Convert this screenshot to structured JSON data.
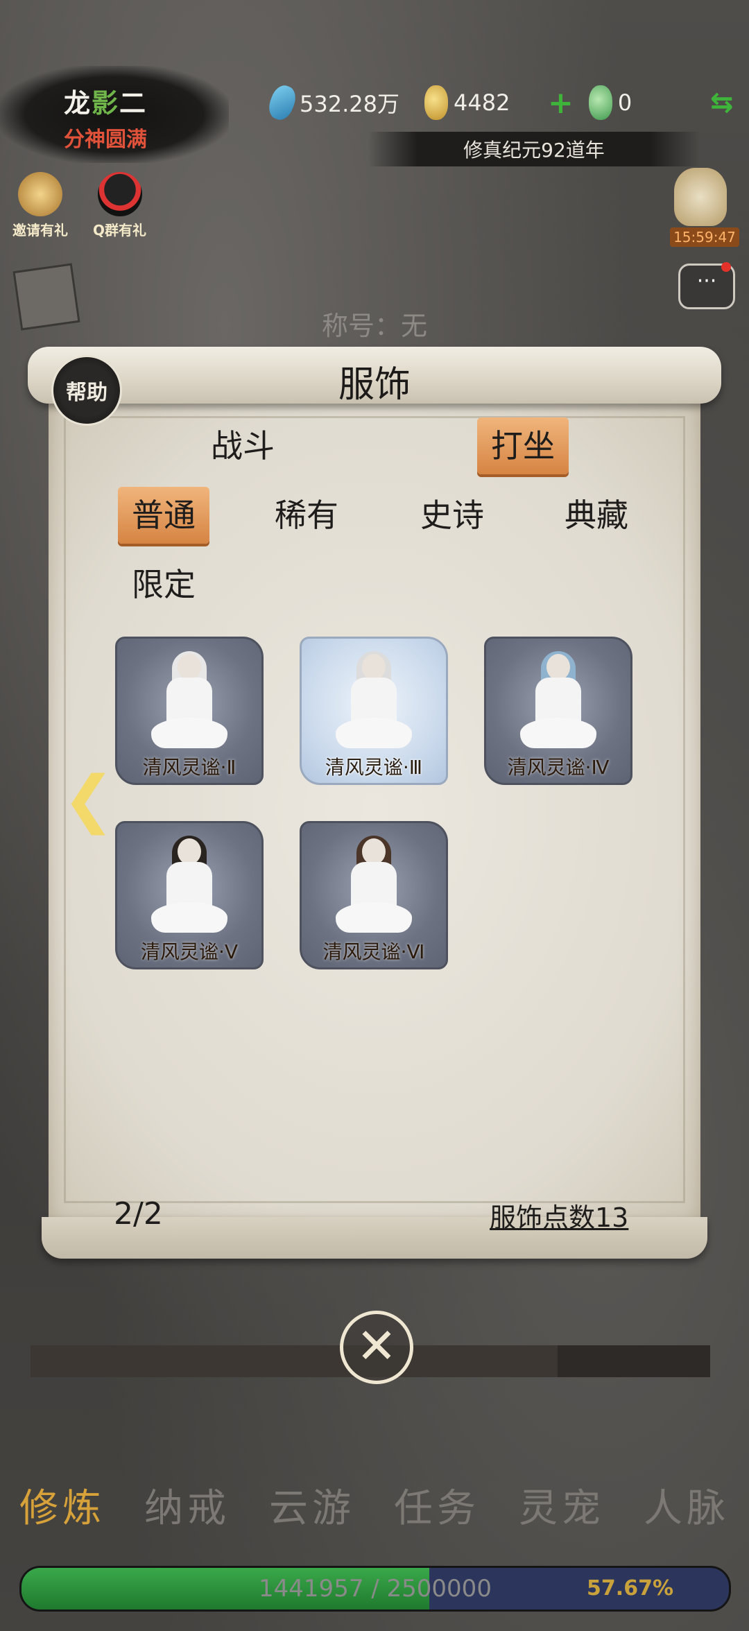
{
  "header": {
    "name_prefix": "龙",
    "name_mark": "影",
    "name_suffix": "二",
    "realm": "分神圆满",
    "spirit_stones": "532.28万",
    "gold": "4482",
    "jade": "0",
    "era": "修真纪元92道年",
    "timer": "15:59:47"
  },
  "side": {
    "invite_label": "邀请有礼",
    "qq_label": "Q群有礼"
  },
  "title_line": "称号：无",
  "panel": {
    "help_label": "帮助",
    "title": "服饰",
    "categories": [
      {
        "label": "战斗",
        "active": false
      },
      {
        "label": "打坐",
        "active": true
      }
    ],
    "rarities": [
      {
        "label": "普通",
        "active": true
      },
      {
        "label": "稀有",
        "active": false
      },
      {
        "label": "史诗",
        "active": false
      },
      {
        "label": "典藏",
        "active": false
      },
      {
        "label": "限定",
        "active": false
      }
    ],
    "items": [
      {
        "label": "清风灵谧·Ⅱ"
      },
      {
        "label": "清风灵谧·Ⅲ"
      },
      {
        "label": "清风灵谧·Ⅳ"
      },
      {
        "label": "清风灵谧·Ⅴ"
      },
      {
        "label": "清风灵谧·Ⅵ"
      }
    ],
    "page": "2/2",
    "points": "服饰点数13",
    "arrow_left": "❮"
  },
  "close_symbol": "✕",
  "nav": [
    "修炼",
    "纳戒",
    "云游",
    "任务",
    "灵宠",
    "人脉"
  ],
  "exp": {
    "text": "1441957 / 2500000",
    "percent": "57.67%"
  }
}
